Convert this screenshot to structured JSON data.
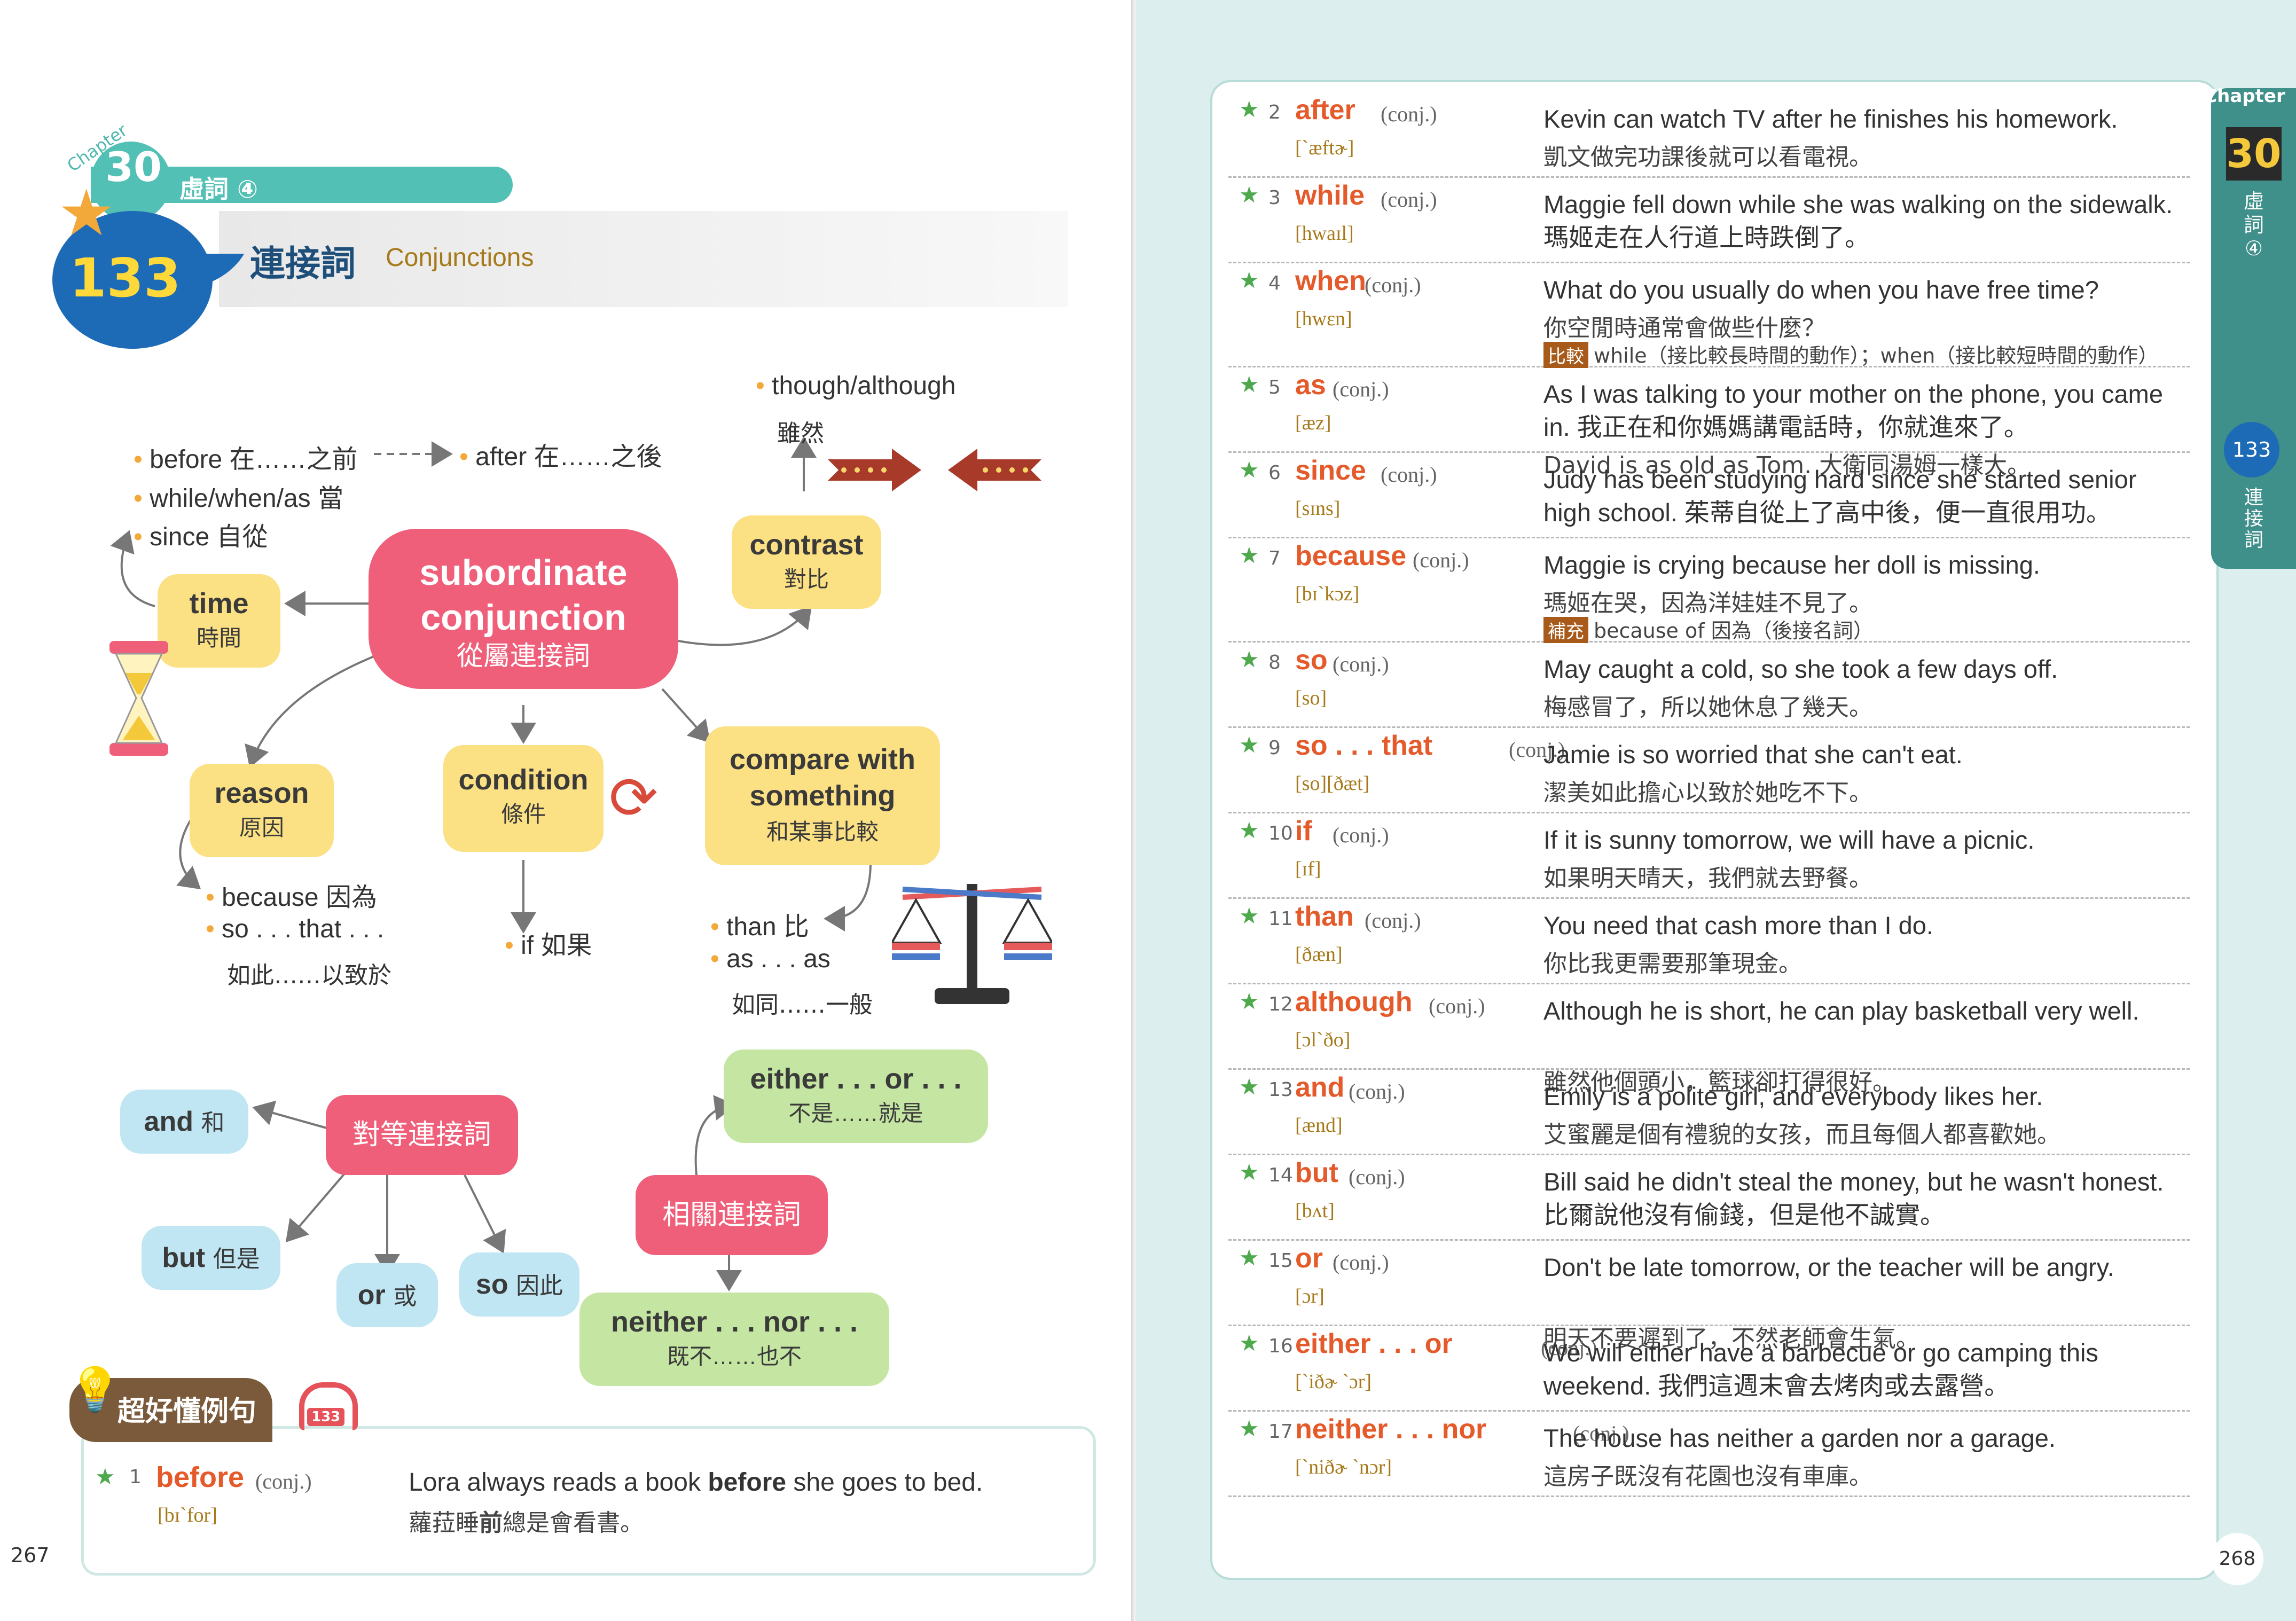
{
  "left_page": {
    "chapter_word": "Chapter",
    "chapter_number": "30",
    "chapter_title": "虛詞 ④",
    "lesson_number": "133",
    "lesson_title_zh": "連接詞",
    "lesson_title_en": "Conjunctions",
    "page_number": "267",
    "mindmap": {
      "center": {
        "en_line1": "subordinate",
        "en_line2": "conjunction",
        "zh": "從屬連接詞"
      },
      "time": {
        "en": "time",
        "zh": "時間"
      },
      "contrast": {
        "en": "contrast",
        "zh": "對比"
      },
      "reason": {
        "en": "reason",
        "zh": "原因"
      },
      "condition": {
        "en": "condition",
        "zh": "條件"
      },
      "compare": {
        "en_line1": "compare with",
        "en_line2": "something",
        "zh": "和某事比較"
      },
      "time_items": [
        "before 在……之前",
        "after 在……之後",
        "while/when/as 當",
        "since 自從"
      ],
      "contrast_items": {
        "en": "though/although",
        "zh": "雖然"
      },
      "reason_items": {
        "because": "because 因為",
        "so_that": "so . . . that . . .",
        "so_that_zh": "如此……以致於"
      },
      "condition_items": "if 如果",
      "compare_items": {
        "than": "than 比",
        "as_as": "as . . . as",
        "as_as_zh": "如同……一般"
      },
      "coordinating": {
        "zh": "對等連接詞"
      },
      "coord_items": {
        "and": "and",
        "and_zh": "和",
        "but": "but",
        "but_zh": "但是",
        "or": "or",
        "or_zh": "或",
        "so": "so",
        "so_zh": "因此"
      },
      "correlative": {
        "zh": "相關連接詞"
      },
      "corr_items": {
        "either": "either . . . or . . .",
        "either_zh": "不是……就是",
        "neither": "neither . . . nor . . .",
        "neither_zh": "既不……也不"
      }
    },
    "examples_label": "超好懂例句",
    "audio_track": "133",
    "entry1": {
      "num": "1",
      "word": "before",
      "pos": "(conj.)",
      "phon": "[bɪˋfor]",
      "en_pre": "Lora always reads a book ",
      "en_hl": "before",
      "en_post": " she goes to bed.",
      "zh_pre": "蘿菈睡",
      "zh_hl": "前",
      "zh_post": "總是會看書。"
    }
  },
  "right_page": {
    "page_number": "268",
    "tab": {
      "chapter_word": "Chapter",
      "chapter_number": "30",
      "chapter_zh": "虛詞④",
      "lesson_number": "133",
      "lesson_zh": "連接詞"
    },
    "entries": [
      {
        "num": "2",
        "word": "after",
        "pos": "(conj.)",
        "phon": "[ˋæftɚ]",
        "en": "Kevin can watch TV after he finishes his homework.",
        "zh": "凱文做完功課後就可以看電視。"
      },
      {
        "num": "3",
        "word": "while",
        "pos": "(conj.)",
        "phon": "[hwaɪl]",
        "en": "Maggie fell down while she was walking on the sidewalk. 瑪姬走在人行道上時跌倒了。",
        "zh": ""
      },
      {
        "num": "4",
        "word": "when",
        "pos": "(conj.)",
        "phon": "[hwɛn]",
        "en": "What do you usually do when you have free time?",
        "zh": "你空閒時通常會做些什麼？",
        "note_badge": "比較",
        "note": "while（接比較長時間的動作）；when（接比較短時間的動作）"
      },
      {
        "num": "5",
        "word": "as",
        "pos": "(conj.)",
        "phon": "[æz]",
        "en": "As I was talking to your mother on the phone, you came in. 我正在和你媽媽講電話時，你就進來了。",
        "zh": "David is as old as Tom. 大衛同湯姆一樣大。"
      },
      {
        "num": "6",
        "word": "since",
        "pos": "(conj.)",
        "phon": "[sɪns]",
        "en": "Judy has been studying hard since she started senior high school. 茱蒂自從上了高中後，便一直很用功。",
        "zh": ""
      },
      {
        "num": "7",
        "word": "because",
        "pos": "(conj.)",
        "phon": "[bɪˋkɔz]",
        "en": "Maggie is crying because her doll is missing.",
        "zh": "瑪姬在哭，因為洋娃娃不見了。",
        "note_badge": "補充",
        "note": "because of 因為（後接名詞）"
      },
      {
        "num": "8",
        "word": "so",
        "pos": "(conj.)",
        "phon": "[so]",
        "en": "May caught a cold, so she took a few days off.",
        "zh": "梅感冒了，所以她休息了幾天。"
      },
      {
        "num": "9",
        "word": "so . . . that",
        "pos": "(conj.)",
        "phon": "[so][ðæt]",
        "en": "Jamie is so worried that she can't eat.",
        "zh": "潔美如此擔心以致於她吃不下。"
      },
      {
        "num": "10",
        "word": "if",
        "pos": "(conj.)",
        "phon": "[ɪf]",
        "en": "If it is sunny tomorrow, we will have a picnic.",
        "zh": "如果明天晴天，我們就去野餐。"
      },
      {
        "num": "11",
        "word": "than",
        "pos": "(conj.)",
        "phon": "[ðæn]",
        "en": "You need that cash more than I do.",
        "zh": "你比我更需要那筆現金。"
      },
      {
        "num": "12",
        "word": "although",
        "pos": "(conj.)",
        "phon": "[ɔlˋðo]",
        "en": "Although he is short, he can play basketball very well.",
        "zh": "雖然他個頭小，籃球卻打得很好。"
      },
      {
        "num": "13",
        "word": "and",
        "pos": "(conj.)",
        "phon": "[ænd]",
        "en": "Emily is a polite girl, and everybody likes her.",
        "zh": "艾蜜麗是個有禮貌的女孩，而且每個人都喜歡她。"
      },
      {
        "num": "14",
        "word": "but",
        "pos": "(conj.)",
        "phon": "[bʌt]",
        "en": "Bill said he didn't steal the money, but he wasn't honest. 比爾說他沒有偷錢，但是他不誠實。",
        "zh": ""
      },
      {
        "num": "15",
        "word": "or",
        "pos": "(conj.)",
        "phon": "[ɔr]",
        "en": "Don't be late tomorrow, or the teacher will be angry.",
        "zh": "明天不要遲到了，不然老師會生氣。"
      },
      {
        "num": "16",
        "word": "either . . . or",
        "pos": "(conj.)",
        "phon": "[ˋiðɚ ˋɔr]",
        "en": "We will either have a barbecue or go camping this weekend. 我們這週末會去烤肉或去露營。",
        "zh": ""
      },
      {
        "num": "17",
        "word": "neither . . . nor",
        "pos": "(conj.)",
        "phon": "[ˋniðɚ ˋnɔr]",
        "en": "The house has neither a garden nor a garage.",
        "zh": "這房子既沒有花園也沒有車庫。"
      }
    ]
  },
  "colors": {
    "teal": "#52c0b5",
    "blue": "#1d6bb7",
    "pink": "#ef5f7a",
    "yellow": "#fbe184",
    "green": "#c5e5a2",
    "light_blue": "#bfe6f2",
    "orange_word": "#e55a2a"
  }
}
